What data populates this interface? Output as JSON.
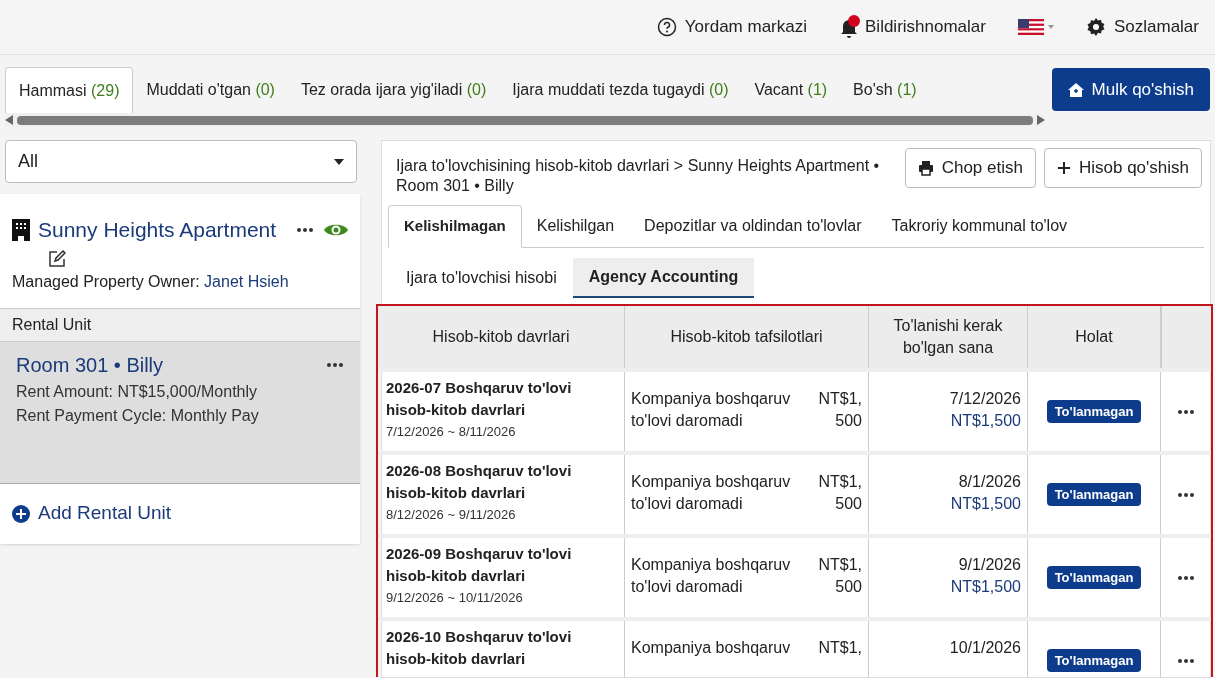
{
  "header": {
    "links": [
      {
        "kind": "help",
        "label": "Yordam markazi"
      },
      {
        "kind": "notifications",
        "label": "Bildirishnomalar"
      },
      {
        "kind": "language"
      },
      {
        "kind": "settings",
        "label": "Sozlamalar"
      }
    ]
  },
  "tabs": [
    {
      "label": "Hammasi",
      "count": "(29)",
      "selected": true
    },
    {
      "label": "Muddati o'tgan",
      "count": "(0)",
      "selected": false
    },
    {
      "label": "Tez orada ijara yig'iladi",
      "count": "(0)",
      "selected": false
    },
    {
      "label": "Ijara muddati tezda tugaydi",
      "count": "(0)",
      "selected": false
    },
    {
      "label": "Vacant",
      "count": "(1)",
      "selected": false
    },
    {
      "label": "Bo'sh",
      "count": "(1)",
      "selected": false
    }
  ],
  "add_property_button": "Mulk qo'shish",
  "filter": {
    "value": "All"
  },
  "property": {
    "name": "Sunny Heights Apartment",
    "owner_label": "Managed Property Owner:",
    "owner_name": "Janet Hsieh"
  },
  "rental_unit_header": "Rental Unit",
  "units": [
    {
      "title": "Room 301 • Billy",
      "rent": "Rent Amount: NT$15,000/Monthly",
      "cycle": "Rent Payment Cycle: Monthly Pay",
      "selected": true
    }
  ],
  "add_unit": "Add Rental Unit",
  "breadcrumb": "Ijara to'lovchisining hisob-kitob davrlari > Sunny Heights Apartment • Room 301 • Billy",
  "actions": [
    {
      "kind": "print",
      "label": "Chop etish"
    },
    {
      "kind": "add",
      "label": "Hisob qo'shish"
    }
  ],
  "ledger_tabs": [
    {
      "label": "Kelishilmagan",
      "selected": true
    },
    {
      "label": "Kelishilgan",
      "selected": false
    },
    {
      "label": "Depozitlar va oldindan to'lovlar",
      "selected": false
    },
    {
      "label": "Takroriy kommunal to'lov",
      "selected": false
    }
  ],
  "sub_tabs": [
    {
      "label": "Ijara to'lovchisi hisobi",
      "selected": false
    },
    {
      "label": "Agency Accounting",
      "selected": true
    }
  ],
  "table": {
    "columns": [
      "Hisob-kitob davrlari",
      "Hisob-kitob tafsilotlari",
      "To'lanishi kerak bo'lgan sana",
      "Holat"
    ],
    "rows": [
      {
        "title": "2026-07 Boshqaruv to'lovi hisob-kitob davrlari",
        "period": "7/12/2026 ~ 8/11/2026",
        "detail": "Kompaniya boshqaruv to'lovi daromadi",
        "amount": "NT$1, 500",
        "due_date": "7/12/2026",
        "due_amount": "NT$1,500",
        "status": "To'lanmagan"
      },
      {
        "title": "2026-08 Boshqaruv to'lovi hisob-kitob davrlari",
        "period": "8/12/2026 ~ 9/11/2026",
        "detail": "Kompaniya boshqaruv to'lovi daromadi",
        "amount": "NT$1, 500",
        "due_date": "8/1/2026",
        "due_amount": "NT$1,500",
        "status": "To'lanmagan"
      },
      {
        "title": "2026-09 Boshqaruv to'lovi hisob-kitob davrlari",
        "period": "9/12/2026 ~ 10/11/2026",
        "detail": "Kompaniya boshqaruv to'lovi daromadi",
        "amount": "NT$1, 500",
        "due_date": "9/1/2026",
        "due_amount": "NT$1,500",
        "status": "To'lanmagan"
      },
      {
        "title": "2026-10 Boshqaruv to'lovi hisob-kitob davrlari",
        "detail": "Kompaniya boshqaruv",
        "amount": "NT$1,",
        "due_date": "10/1/2026",
        "status": "To'lanmagan"
      }
    ]
  }
}
